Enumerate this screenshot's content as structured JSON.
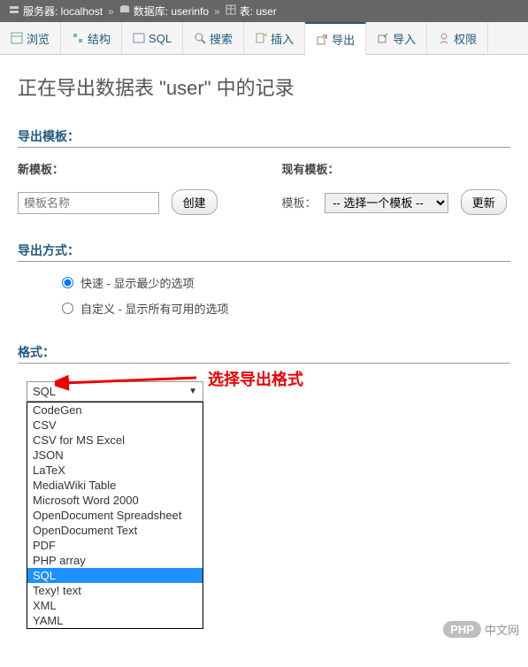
{
  "breadcrumb": {
    "server_label": "服务器: localhost",
    "database_label": "数据库: userinfo",
    "table_label": "表: user"
  },
  "tabs": [
    {
      "id": "browse",
      "label": "浏览"
    },
    {
      "id": "structure",
      "label": "结构"
    },
    {
      "id": "sql",
      "label": "SQL"
    },
    {
      "id": "search",
      "label": "搜索"
    },
    {
      "id": "insert",
      "label": "插入"
    },
    {
      "id": "export",
      "label": "导出"
    },
    {
      "id": "import",
      "label": "导入"
    },
    {
      "id": "privileges",
      "label": "权限"
    }
  ],
  "heading": "正在导出数据表 \"user\" 中的记录",
  "sections": {
    "export_template_title": "导出模板：",
    "new_template_label": "新模板：",
    "new_template_placeholder": "模板名称",
    "create_button": "创建",
    "existing_template_label": "现有模板：",
    "template_inline_label": "模板：",
    "template_select_value": "-- 选择一个模板 --",
    "update_button": "更新",
    "export_method_title": "导出方式：",
    "radio_quick": "快速 - 显示最少的选项",
    "radio_custom": "自定义 - 显示所有可用的选项",
    "format_title": "格式："
  },
  "annotation_text": "选择导出格式",
  "format": {
    "selected": "SQL",
    "options": [
      "CodeGen",
      "CSV",
      "CSV for MS Excel",
      "JSON",
      "LaTeX",
      "MediaWiki Table",
      "Microsoft Word 2000",
      "OpenDocument Spreadsheet",
      "OpenDocument Text",
      "PDF",
      "PHP array",
      "SQL",
      "Texy! text",
      "XML",
      "YAML"
    ]
  },
  "watermark": {
    "badge": "PHP",
    "text": "中文网"
  }
}
